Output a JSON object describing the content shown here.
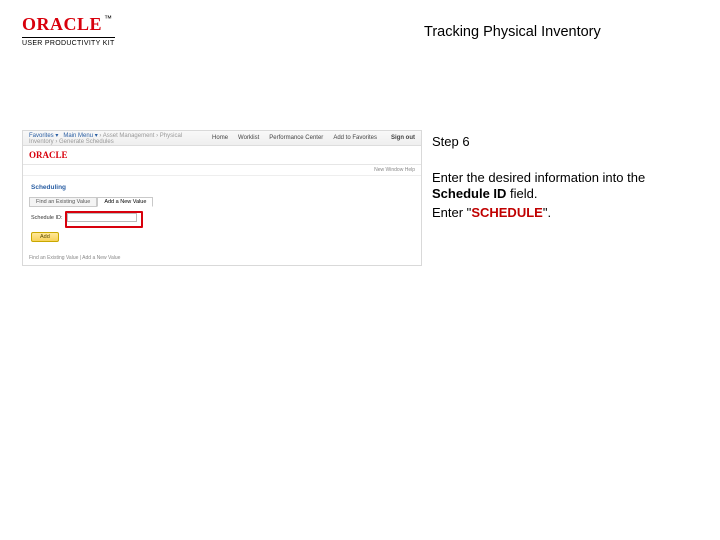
{
  "header": {
    "brand_name": "ORACLE",
    "brand_tm": "™",
    "brand_sub": "USER PRODUCTIVITY KIT",
    "doc_title": "Tracking Physical Inventory"
  },
  "app": {
    "topbar": {
      "bc_prefix": "Favorites ▾",
      "bc_main": "Main Menu ▾",
      "bc_rest": "› Asset Management › Physical Inventory › Generate Schedules",
      "menus": [
        "Home",
        "Worklist",
        "Performance Center",
        "Add to Favorites"
      ],
      "signout": "Sign out"
    },
    "logo2": "ORACLE",
    "status": "New Window   Help   ",
    "heading": "Scheduling",
    "tabs": [
      {
        "label": "Find an Existing Value",
        "active": false
      },
      {
        "label": "Add a New Value",
        "active": true
      }
    ],
    "field_label": "Schedule ID:",
    "field_value": "",
    "add_btn": "Add",
    "motd": "Find an Existing Value | Add a New Value"
  },
  "panel": {
    "step": "Step 6",
    "line1a": "Enter the desired information into the ",
    "line1b_bold": "Schedule ID",
    "line1c": " field.",
    "line2a": "Enter \"",
    "line2b_quote": "SCHEDULE",
    "line2c": "\"."
  }
}
